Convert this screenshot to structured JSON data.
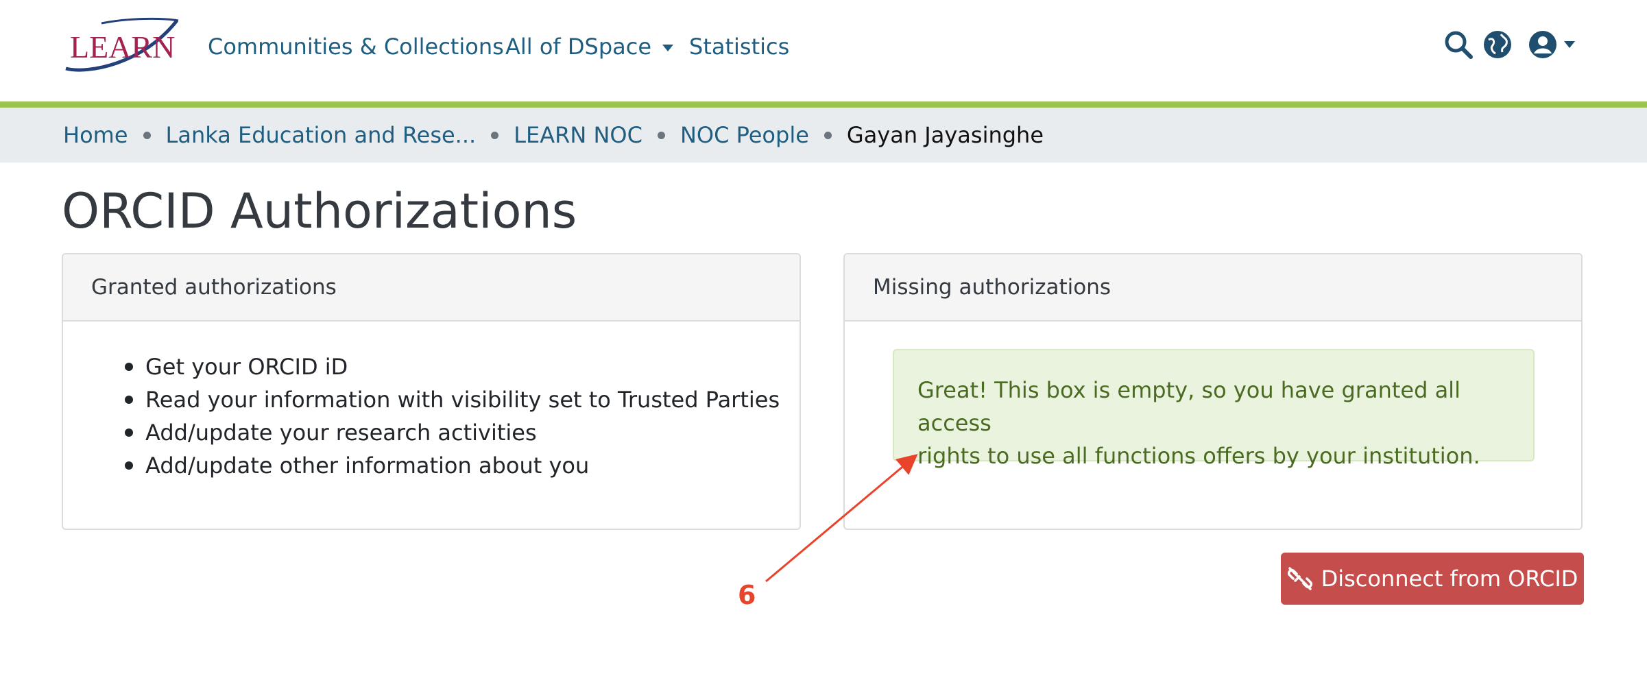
{
  "header": {
    "logo_text": "LEARN",
    "nav": {
      "communities": "Communities & Collections",
      "all_of_dspace": "All of DSpace",
      "statistics": "Statistics"
    },
    "icons": [
      "search-icon",
      "globe-icon",
      "user-icon"
    ],
    "accent_color": "#9bc34f"
  },
  "breadcrumb": {
    "items": [
      "Home",
      "Lanka Education and Rese...",
      "LEARN NOC",
      "NOC People",
      "Gayan Jayasinghe"
    ]
  },
  "page": {
    "title": "ORCID Authorizations"
  },
  "granted": {
    "header": "Granted authorizations",
    "items": [
      "Get your ORCID iD",
      "Read your information with visibility set to Trusted Parties",
      "Add/update your research activities",
      "Add/update other information about you"
    ]
  },
  "missing": {
    "header": "Missing authorizations",
    "alert_line1": "Great! This box is empty, so you have granted all access",
    "alert_line2": "rights to use all functions offers by your institution."
  },
  "actions": {
    "disconnect_label": "Disconnect from ORCID",
    "disconnect_color": "#c54e4c"
  },
  "annotation": {
    "label": "6",
    "color": "#e8442b"
  }
}
